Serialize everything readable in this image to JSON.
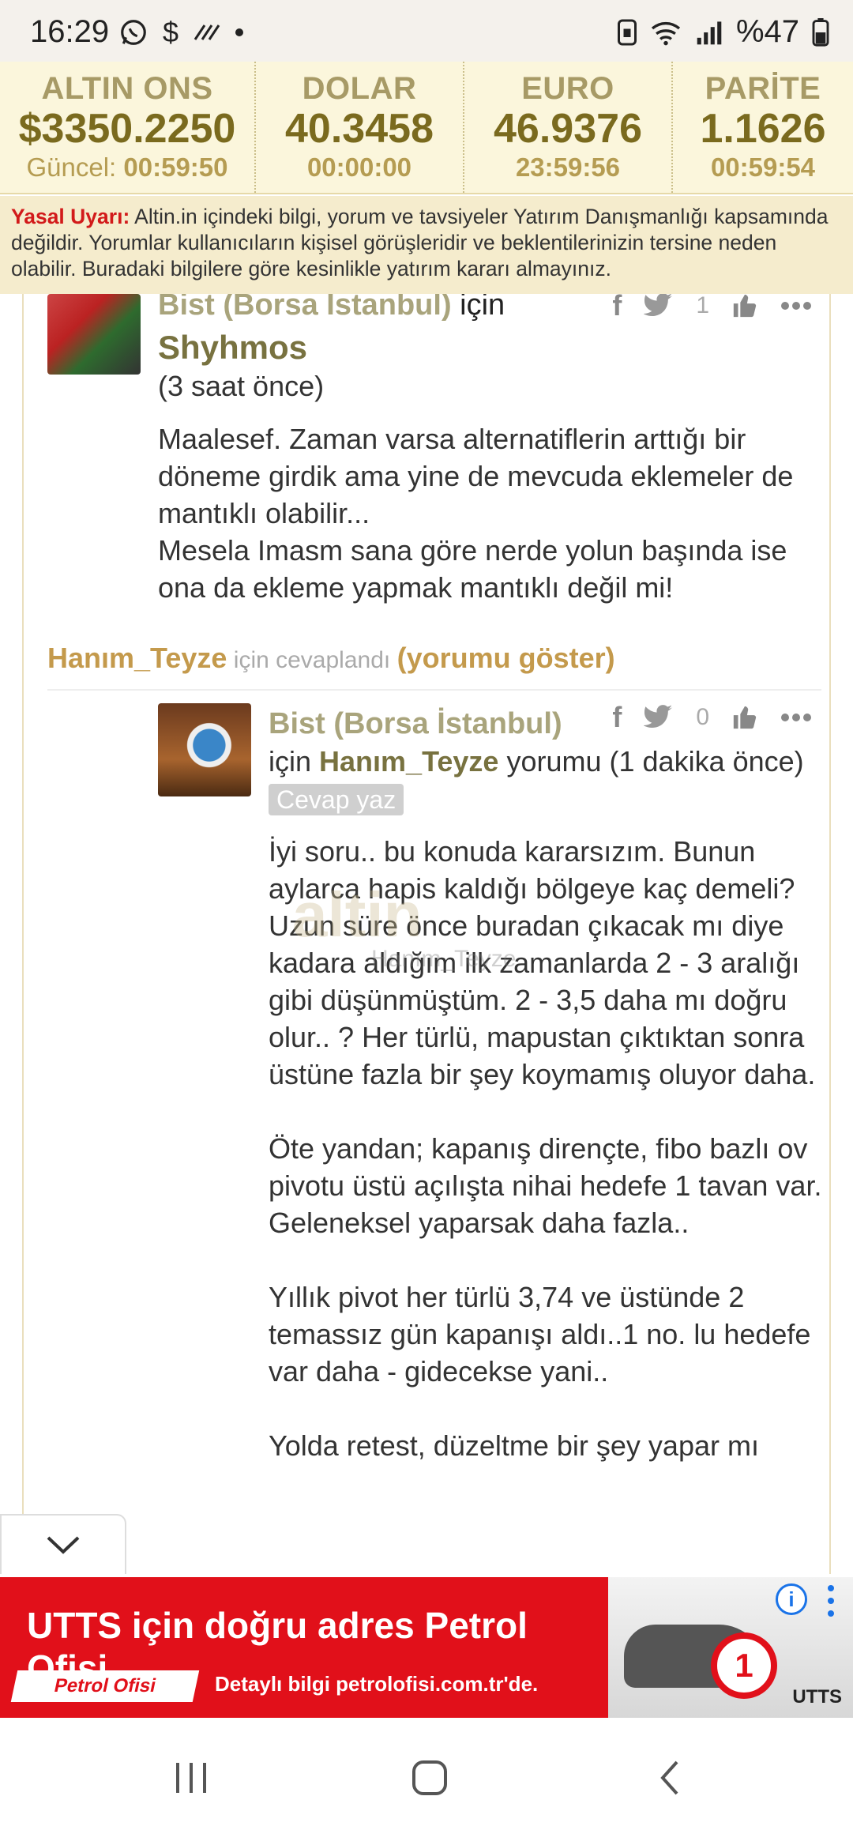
{
  "status_bar": {
    "time": "16:29",
    "battery": "%47"
  },
  "ticker": [
    {
      "name": "ALTIN ONS",
      "price": "$3350.2250",
      "time_label": "Güncel:",
      "time": "00:59:50"
    },
    {
      "name": "DOLAR",
      "price": "40.3458",
      "time_label": "",
      "time": "00:00:00"
    },
    {
      "name": "EURO",
      "price": "46.9376",
      "time_label": "",
      "time": "23:59:56"
    },
    {
      "name": "PARİTE",
      "price": "1.1626",
      "time_label": "",
      "time": "00:59:54"
    }
  ],
  "disclaimer": {
    "warning_label": "Yasal Uyarı:",
    "text": " Altin.in içindeki bilgi, yorum ve tavsiyeler Yatırım Danışmanlığı kapsamında değildir. Yorumlar kullanıcıların kişisel görüşleridir ve beklentilerinizin tersine neden olabilir. Buradaki bilgilere göre kesinlikle yatırım kararı almayınız."
  },
  "comment1": {
    "topic": "Bist (Borsa İstanbul)",
    "for_word": " için",
    "user": "Shyhmos",
    "time": "(3 saat önce)",
    "body": "Maalesef. Zaman varsa alternatiflerin arttığı bir döneme girdik ama yine de mevcuda eklemeler de mantıklı olabilir...\nMesela Imasm sana göre nerde yolun başında ise ona da ekleme yapmak mantıklı değil mi!",
    "like_count": "1"
  },
  "reply_line": {
    "user": "Hanım_Teyze",
    "middle": " için cevaplandı ",
    "show": "(yorumu göster)"
  },
  "comment2": {
    "topic": "Bist (Borsa İstanbul)",
    "for_word": "için ",
    "user": "Hanım_Teyze",
    "suffix": " yorumu (1 dakika önce) ",
    "reply_button": "Cevap yaz",
    "like_count": "0",
    "paragraphs": [
      "İyi soru.. bu konuda kararsızım. Bunun aylarca hapis kaldığı bölgeye kaç demeli? Uzun süre önce buradan çıkacak mı diye kadara aldığım ilk zamanlarda 2 - 3 aralığı gibi düşünmüştüm. 2 - 3,5 daha mı doğru olur.. ? Her türlü, mapustan çıktıktan sonra üstüne fazla bir şey koymamış oluyor daha.",
      "Öte yandan; kapanış dirençte, fibo bazlı ov pivotu üstü açılışta nihai hedefe 1 tavan var. Geleneksel yaparsak daha fazla..",
      "Yıllık pivot her türlü 3,74 ve üstünde 2 temassız gün kapanışı aldı..1 no. lu hedefe var daha - gidecekse yani..",
      "Yolda retest, düzeltme bir şey yapar mı"
    ]
  },
  "watermark": {
    "logo": "altin",
    "tag": "Hanım_Teyze"
  },
  "ad": {
    "title": "UTTS için doğru adres Petrol Ofisi",
    "brand": "Petrol Ofisi",
    "subtitle": "Detaylı bilgi petrolofisi.com.tr'de.",
    "badge": "1",
    "product": "UTTS",
    "info": "i"
  },
  "colors": {
    "ticker_bg": "#fbf6dc",
    "disclaimer_bg": "#f5eccd",
    "warning_red": "#d21a1a",
    "ad_red": "#e1101a",
    "accent_gold": "#c49a4c"
  }
}
